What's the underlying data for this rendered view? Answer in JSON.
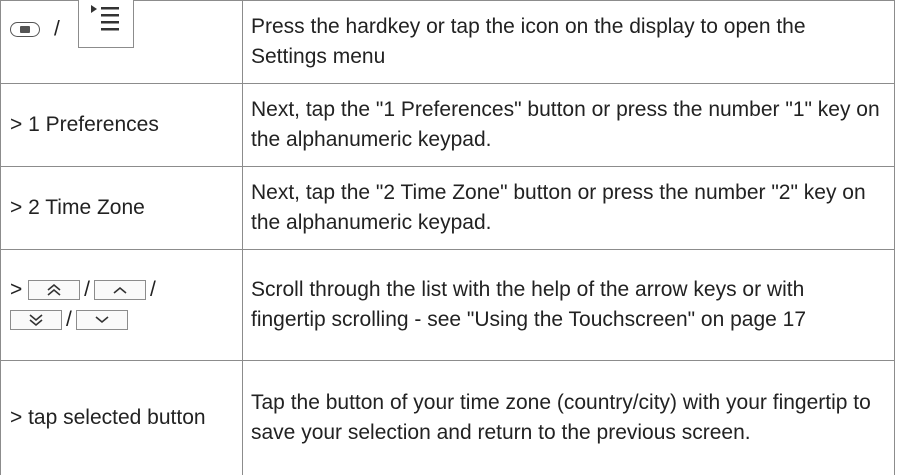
{
  "rows": [
    {
      "left_sep": "/",
      "right": "Press the hardkey or tap the icon on the display to open the Settings menu"
    },
    {
      "left": "> 1 Preferences",
      "right": "Next, tap the \"1 Preferences\" button or press the number \"1\" key on the alphanumeric keypad."
    },
    {
      "left": "> 2 Time Zone",
      "right": "Next, tap the \"2 Time Zone\" button or press the number \"2\" key on the alphanumeric keypad."
    },
    {
      "left_prefix": ">",
      "sep": "/",
      "right": "Scroll through the list with the help of the arrow keys or with fingertip scrolling - see \"Using the Touchscreen\" on page 17"
    },
    {
      "left": "> tap selected button",
      "right": "Tap the button of your time zone (country/city) with your fingertip to save your selection and return to the previous screen."
    }
  ],
  "icons": {
    "hardkey": "settings-hardkey-icon",
    "menu": "settings-menu-icon",
    "page_up": "double-chevron-up-icon",
    "line_up": "chevron-up-icon",
    "page_down": "double-chevron-down-icon",
    "line_down": "chevron-down-icon"
  }
}
